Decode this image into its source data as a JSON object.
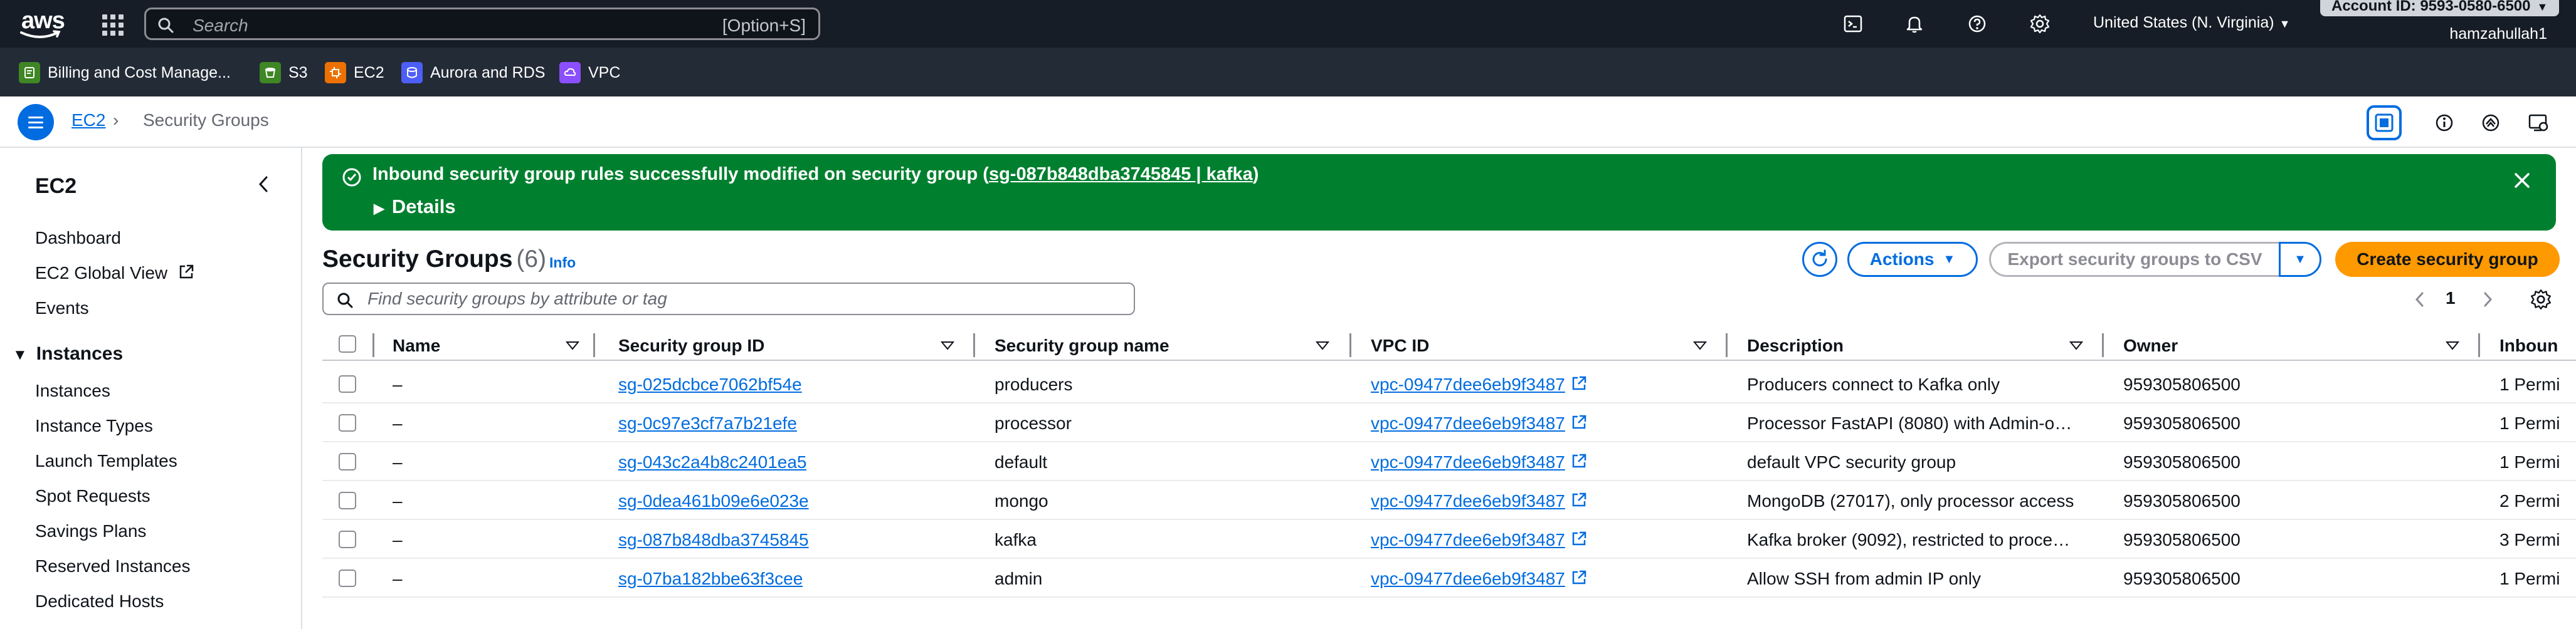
{
  "topnav": {
    "logo_text": "aws",
    "search_placeholder": "Search",
    "search_shortcut": "[Option+S]",
    "region": "United States (N. Virginia)",
    "account_id": "Account ID: 9593-0580-6500",
    "username": "hamzahullah1",
    "icons": [
      "cloudshell-icon",
      "bell-icon",
      "help-icon",
      "gear-icon"
    ]
  },
  "favorites": [
    {
      "label": "Billing and Cost Manage...",
      "color": "#3f8624",
      "icon": "billing-icon"
    },
    {
      "label": "S3",
      "color": "#3f8624",
      "icon": "s3-icon"
    },
    {
      "label": "EC2",
      "color": "#ed7100",
      "icon": "ec2-icon"
    },
    {
      "label": "Aurora and RDS",
      "color": "#4d5ff7",
      "icon": "rds-icon"
    },
    {
      "label": "VPC",
      "color": "#8c4fff",
      "icon": "vpc-icon"
    }
  ],
  "breadcrumb": {
    "root": "EC2",
    "current": "Security Groups"
  },
  "sidebar": {
    "title": "EC2",
    "items": [
      {
        "label": "Dashboard"
      },
      {
        "label": "EC2 Global View"
      },
      {
        "label": "Events"
      }
    ],
    "section": "Instances",
    "section_items": [
      {
        "label": "Instances"
      },
      {
        "label": "Instance Types"
      },
      {
        "label": "Launch Templates"
      },
      {
        "label": "Spot Requests"
      },
      {
        "label": "Savings Plans"
      },
      {
        "label": "Reserved Instances"
      },
      {
        "label": "Dedicated Hosts"
      }
    ]
  },
  "flash": {
    "message": "Inbound security group rules successfully modified on security group (",
    "link": "sg-087b848dba3745845 | kafka",
    "message_end": ")",
    "details": "Details",
    "color": "#00802f"
  },
  "main": {
    "title": "Security Groups",
    "count": "(6)",
    "info": "Info",
    "actions_label": "Actions",
    "export_label": "Export security groups to CSV",
    "create_label": "Create security group",
    "filter_placeholder": "Find security groups by attribute or tag",
    "page": "1"
  },
  "table": {
    "columns": [
      "Name",
      "Security group ID",
      "Security group name",
      "VPC ID",
      "Description",
      "Owner",
      "Inboun"
    ],
    "rows": [
      {
        "name": "–",
        "sg_id": "sg-025dcbce7062bf54e",
        "sg_name": "producers",
        "vpc": "vpc-09477dee6eb9f3487",
        "desc": "Producers connect to Kafka only",
        "owner": "959305806500",
        "inbound": "1 Permi"
      },
      {
        "name": "–",
        "sg_id": "sg-0c97e3cf7a7b21efe",
        "sg_name": "processor",
        "vpc": "vpc-09477dee6eb9f3487",
        "desc": "Processor FastAPI (8080) with Admin-o…",
        "owner": "959305806500",
        "inbound": "1 Permi"
      },
      {
        "name": "–",
        "sg_id": "sg-043c2a4b8c2401ea5",
        "sg_name": "default",
        "vpc": "vpc-09477dee6eb9f3487",
        "desc": "default VPC security group",
        "owner": "959305806500",
        "inbound": "1 Permi"
      },
      {
        "name": "–",
        "sg_id": "sg-0dea461b09e6e023e",
        "sg_name": "mongo",
        "vpc": "vpc-09477dee6eb9f3487",
        "desc": "MongoDB (27017), only processor access",
        "owner": "959305806500",
        "inbound": "2 Permi"
      },
      {
        "name": "–",
        "sg_id": "sg-087b848dba3745845",
        "sg_name": "kafka",
        "vpc": "vpc-09477dee6eb9f3487",
        "desc": "Kafka broker (9092), restricted to proce…",
        "owner": "959305806500",
        "inbound": "3 Permi"
      },
      {
        "name": "–",
        "sg_id": "sg-07ba182bbe63f3cee",
        "sg_name": "admin",
        "vpc": "vpc-09477dee6eb9f3487",
        "desc": "Allow SSH from admin IP only",
        "owner": "959305806500",
        "inbound": "1 Permi"
      }
    ]
  },
  "colors": {
    "link": "#006ce0",
    "primary_button": "#ff9900",
    "nav_bg": "#161d26",
    "favbar_bg": "#232b37"
  }
}
